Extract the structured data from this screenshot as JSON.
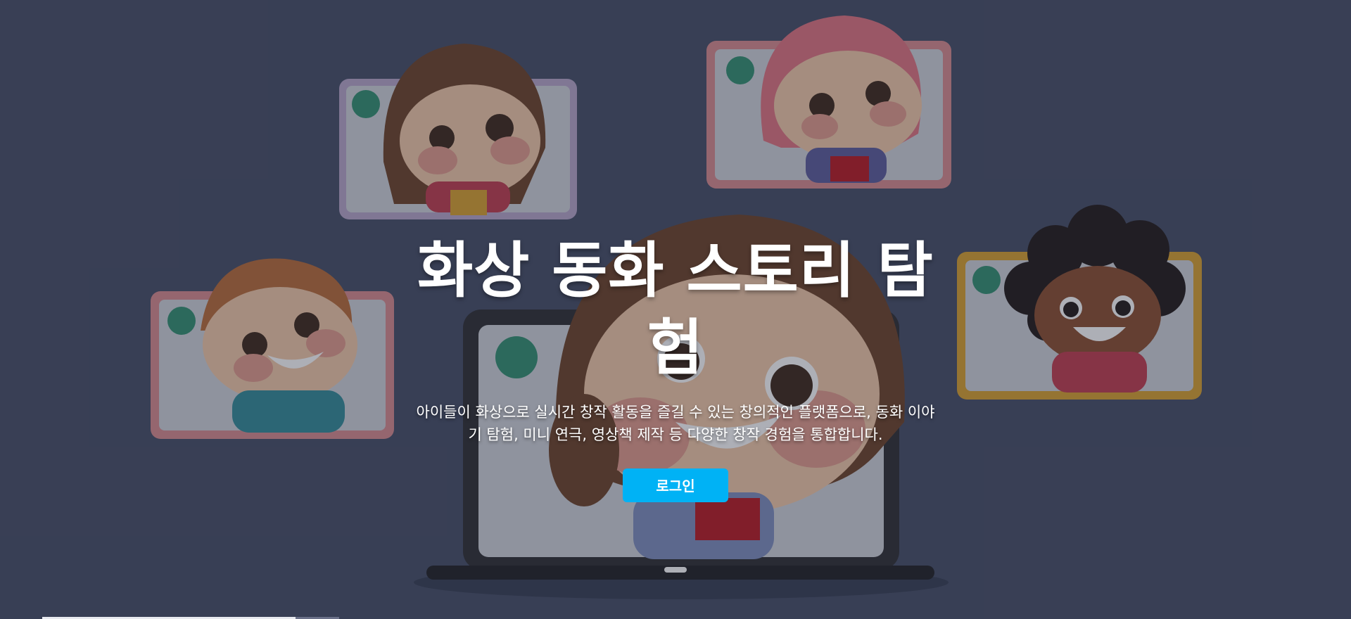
{
  "hero": {
    "title": "화상 동화 스토리 탐험",
    "description": "아이들이 화상으로 실시간 창작 활동을 즐길 수 있는 창의적인 플랫폼으로, 동화 이야기 탐험, 미니 연극, 영상책 제작 등 다양한 창작 경험을 통합합니다.",
    "login_label": "로그인"
  },
  "colors": {
    "background": "#434b63",
    "accent": "#00b2f5",
    "camera_badge": "#2f8f6f"
  },
  "icons": [
    "video-camera-icon",
    "laptop-illustration",
    "child-avatar-illustration"
  ]
}
